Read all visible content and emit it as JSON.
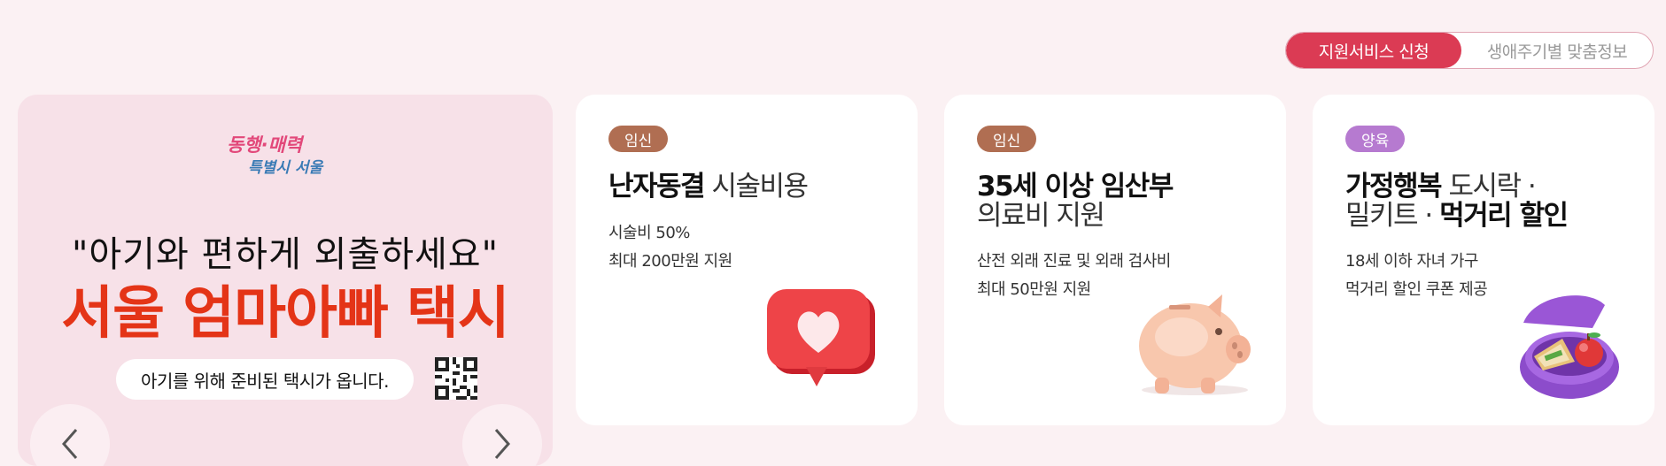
{
  "toggle": {
    "active": "지원서비스 신청",
    "inactive": "생애주기별 맞춤정보"
  },
  "banner": {
    "logo_text": "동행·매력 특별시 서울",
    "quote": "\"아기와 편하게 외출하세요\"",
    "title": "서울 엄마아빠 택시",
    "pill_text": "아기를 위해 준비된 택시가 옵니다."
  },
  "cards": [
    {
      "badge": "임신",
      "badge_color": "#b06e52",
      "title_bold": "난자동결",
      "title_light": " 시술비용",
      "desc1": "시술비 50%",
      "desc2": "최대 200만원 지원",
      "icon": "heart-chat-icon"
    },
    {
      "badge": "임신",
      "badge_color": "#b06e52",
      "title_line1_bold": "35세 이상 임산부",
      "title_line2_light": "의료비 지원",
      "desc1": "산전 외래 진료 및 외래 검사비",
      "desc2": "최대 50만원 지원",
      "icon": "piggy-bank-icon"
    },
    {
      "badge": "양육",
      "badge_color": "#b67ad0",
      "title_line1_bold": "가정행복",
      "title_line1_light": " 도시락 ·",
      "title_line2_light": "밀키트 · ",
      "title_line2_bold": "먹거리 할인",
      "desc1": "18세 이하 자녀 가구",
      "desc2": "먹거리 할인 쿠폰 제공",
      "icon": "lunchbox-icon"
    }
  ]
}
